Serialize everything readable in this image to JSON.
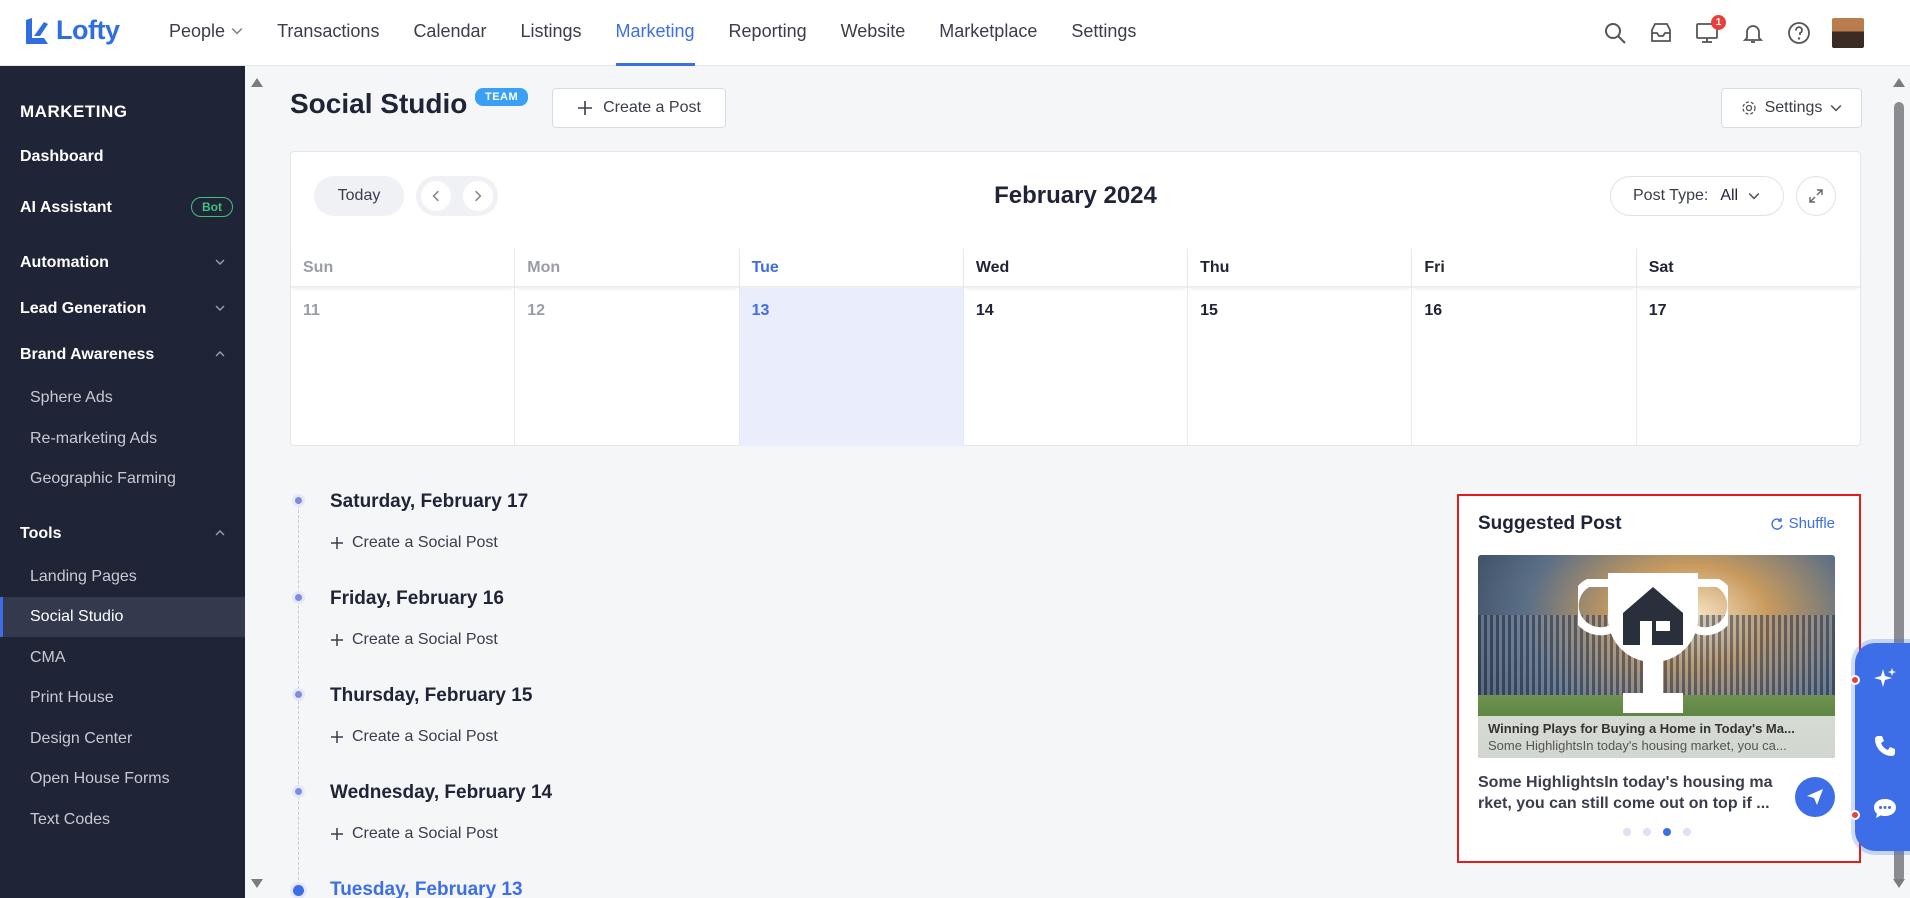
{
  "app": {
    "name": "Lofty"
  },
  "nav": {
    "items": [
      {
        "label": "People",
        "dropdown": true
      },
      {
        "label": "Transactions"
      },
      {
        "label": "Calendar"
      },
      {
        "label": "Listings"
      },
      {
        "label": "Marketing",
        "active": true
      },
      {
        "label": "Reporting"
      },
      {
        "label": "Website"
      },
      {
        "label": "Marketplace"
      },
      {
        "label": "Settings"
      }
    ],
    "notification_count": "1",
    "icons": [
      "search-icon",
      "inbox-icon",
      "monitor-icon",
      "bell-icon",
      "help-icon"
    ]
  },
  "sidebar": {
    "heading": "MARKETING",
    "dashboard": "Dashboard",
    "ai_assistant": "AI Assistant",
    "ai_badge": "Bot",
    "automation": "Automation",
    "lead_generation": "Lead Generation",
    "brand_awareness": "Brand Awareness",
    "brand_items": [
      "Sphere Ads",
      "Re-marketing Ads",
      "Geographic Farming"
    ],
    "tools": "Tools",
    "tool_items": [
      "Landing Pages",
      "Social Studio",
      "CMA",
      "Print House",
      "Design Center",
      "Open House Forms",
      "Text Codes"
    ],
    "active_item": "Social Studio"
  },
  "header": {
    "title": "Social Studio",
    "team_badge": "TEAM",
    "create_post": "Create a Post",
    "settings": "Settings"
  },
  "calendar": {
    "today_label": "Today",
    "month": "February 2024",
    "post_type_label": "Post Type:",
    "post_type_value": "All",
    "days": [
      {
        "dow": "Sun",
        "date": "11",
        "state": "muted"
      },
      {
        "dow": "Mon",
        "date": "12",
        "state": "muted"
      },
      {
        "dow": "Tue",
        "date": "13",
        "state": "today"
      },
      {
        "dow": "Wed",
        "date": "14",
        "state": "normal"
      },
      {
        "dow": "Thu",
        "date": "15",
        "state": "normal"
      },
      {
        "dow": "Fri",
        "date": "16",
        "state": "normal"
      },
      {
        "dow": "Sat",
        "date": "17",
        "state": "normal"
      }
    ]
  },
  "timeline": {
    "create_label": "Create a Social Post",
    "entries": [
      {
        "date": "Saturday, February 17"
      },
      {
        "date": "Friday, February 16"
      },
      {
        "date": "Thursday, February 15"
      },
      {
        "date": "Wednesday, February 14"
      },
      {
        "date": "Tuesday, February 13",
        "active": true
      }
    ]
  },
  "suggested": {
    "title": "Suggested Post",
    "shuffle": "Shuffle",
    "image_title": "Winning Plays for Buying a Home in Today's Ma...",
    "image_subtitle": "Some HighlightsIn today's housing market, you ca...",
    "text_line1": "Some HighlightsIn today's housing ma",
    "text_line2": "rket, you can still come out on top if ...",
    "page_count": 4,
    "active_page": 3
  },
  "colors": {
    "accent": "#3d6ee8",
    "sidebar_bg": "#202437",
    "highlight_border": "#e11d1d",
    "bot_green": "#3fc37a"
  }
}
